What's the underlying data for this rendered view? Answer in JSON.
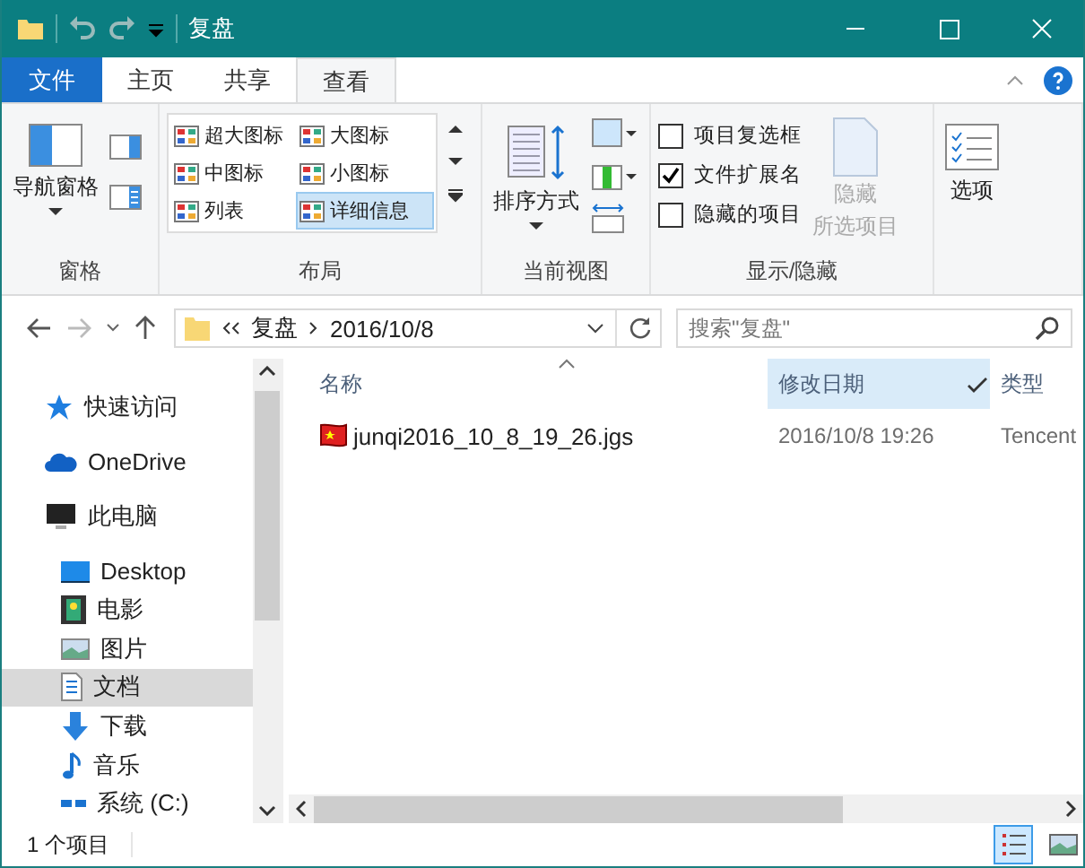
{
  "window": {
    "title": "复盘"
  },
  "ribbon_tabs": [
    {
      "label": "文件",
      "kind": "file",
      "selected": false
    },
    {
      "label": "主页",
      "kind": "tab",
      "selected": false
    },
    {
      "label": "共享",
      "kind": "tab",
      "selected": false
    },
    {
      "label": "查看",
      "kind": "tab",
      "selected": true
    }
  ],
  "ribbon": {
    "panes": {
      "nav_pane": "导航窗格",
      "label": "窗格"
    },
    "layout": {
      "label": "布局",
      "options": [
        {
          "label": "超大图标",
          "selected": false
        },
        {
          "label": "大图标",
          "selected": false
        },
        {
          "label": "中图标",
          "selected": false
        },
        {
          "label": "小图标",
          "selected": false
        },
        {
          "label": "列表",
          "selected": false
        },
        {
          "label": "详细信息",
          "selected": true
        }
      ]
    },
    "current_view": {
      "sort": "排序方式",
      "label": "当前视图"
    },
    "show_hide": {
      "label": "显示/隐藏",
      "checkboxes": [
        {
          "label": "项目复选框",
          "checked": false
        },
        {
          "label": "文件扩展名",
          "checked": true
        },
        {
          "label": "隐藏的项目",
          "checked": false
        }
      ],
      "hide_selected": {
        "label": "隐藏",
        "label_2": "所选项目",
        "disabled": true
      }
    },
    "options": "选项"
  },
  "address": {
    "segments": [
      "复盘",
      "2016/10/8"
    ],
    "search_placeholder": "搜索\"复盘\""
  },
  "sidebar": {
    "items": [
      {
        "label": "快速访问",
        "kind": "star",
        "selected": false
      },
      {
        "label": "OneDrive",
        "kind": "cloud",
        "selected": false
      },
      {
        "label": "此电脑",
        "kind": "pc",
        "selected": false,
        "children": [
          {
            "label": "Desktop",
            "kind": "desktop",
            "selected": false
          },
          {
            "label": "电影",
            "kind": "film",
            "selected": false
          },
          {
            "label": "图片",
            "kind": "picture",
            "selected": false
          },
          {
            "label": "文档",
            "kind": "document",
            "selected": true
          },
          {
            "label": "下载",
            "kind": "download",
            "selected": false
          },
          {
            "label": "音乐",
            "kind": "music",
            "selected": false
          },
          {
            "label": "系统 (C:)",
            "kind": "drive",
            "selected": false
          }
        ]
      }
    ]
  },
  "table": {
    "columns": [
      {
        "label": "名称",
        "selected": false
      },
      {
        "label": "修改日期",
        "selected": true
      },
      {
        "label": "类型",
        "selected": false
      }
    ],
    "rows": [
      {
        "name": "junqi2016_10_8_19_26.jgs",
        "date": "2016/10/8 19:26",
        "type": "Tencent"
      }
    ]
  },
  "status_bar": {
    "count": "1 个项目",
    "views": [
      {
        "kind": "details",
        "selected": true
      },
      {
        "kind": "thumbnails",
        "selected": false
      }
    ]
  }
}
